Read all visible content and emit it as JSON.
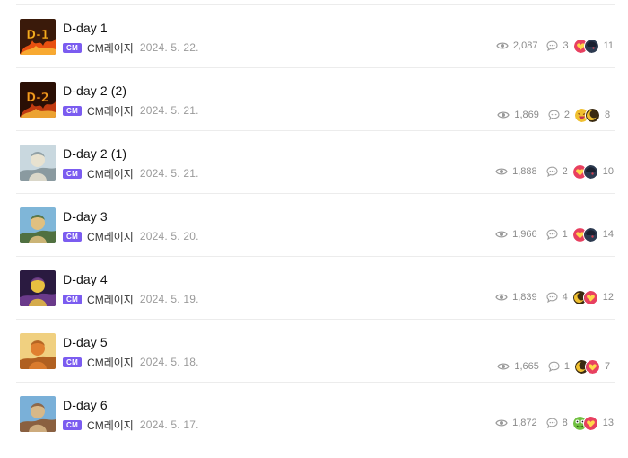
{
  "badge_label": "CM",
  "posts": [
    {
      "title": "D-day 1",
      "author": "CM레이지",
      "date": "2024. 5. 22.",
      "views": "2,087",
      "comments": "3",
      "reaction_count": "11",
      "reactions": [
        "heart-emoji",
        "dark-character-emoji"
      ],
      "thumb": {
        "icon": "fire-title-thumbnail",
        "bg": "#3a1a0a",
        "fg": "#f0b020",
        "accent": "#e85010"
      }
    },
    {
      "title": "D-day 2 (2)",
      "author": "CM레이지",
      "date": "2024. 5. 21.",
      "views": "1,869",
      "comments": "2",
      "reaction_count": "8",
      "reactions": [
        "laughing-emoji",
        "moon-emoji"
      ],
      "thumb": {
        "icon": "fire-title-thumbnail",
        "bg": "#2a0f05",
        "fg": "#f0a020",
        "accent": "#c03a10"
      }
    },
    {
      "title": "D-day 2 (1)",
      "author": "CM레이지",
      "date": "2024. 5. 21.",
      "views": "1,888",
      "comments": "2",
      "reaction_count": "10",
      "reactions": [
        "heart-emoji",
        "dark-character-emoji"
      ],
      "thumb": {
        "icon": "character-thumbnail",
        "bg": "#c9d8df",
        "fg": "#e8e2d0",
        "accent": "#8a9aa0"
      }
    },
    {
      "title": "D-day 3",
      "author": "CM레이지",
      "date": "2024. 5. 20.",
      "views": "1,966",
      "comments": "1",
      "reaction_count": "14",
      "reactions": [
        "heart-emoji",
        "dark-character-emoji"
      ],
      "thumb": {
        "icon": "character-thumbnail",
        "bg": "#7fb6d8",
        "fg": "#e0c080",
        "accent": "#507040"
      }
    },
    {
      "title": "D-day 4",
      "author": "CM레이지",
      "date": "2024. 5. 19.",
      "views": "1,839",
      "comments": "4",
      "reaction_count": "12",
      "reactions": [
        "moon-emoji",
        "heart-emoji"
      ],
      "thumb": {
        "icon": "character-thumbnail",
        "bg": "#2a1a40",
        "fg": "#e8c040",
        "accent": "#6a3a8a"
      }
    },
    {
      "title": "D-day 5",
      "author": "CM레이지",
      "date": "2024. 5. 18.",
      "views": "1,665",
      "comments": "1",
      "reaction_count": "7",
      "reactions": [
        "moon-emoji",
        "heart-emoji"
      ],
      "thumb": {
        "icon": "character-thumbnail",
        "bg": "#f0d080",
        "fg": "#e08030",
        "accent": "#b06020"
      }
    },
    {
      "title": "D-day 6",
      "author": "CM레이지",
      "date": "2024. 5. 17.",
      "views": "1,872",
      "comments": "8",
      "reaction_count": "13",
      "reactions": [
        "frog-emoji",
        "heart-emoji"
      ],
      "thumb": {
        "icon": "character-thumbnail",
        "bg": "#7ab0d8",
        "fg": "#d8b888",
        "accent": "#8a6040"
      }
    }
  ],
  "colors": {
    "badge": "#7b5cf0",
    "divider": "#ececec",
    "muted": "#8a8a8a"
  }
}
